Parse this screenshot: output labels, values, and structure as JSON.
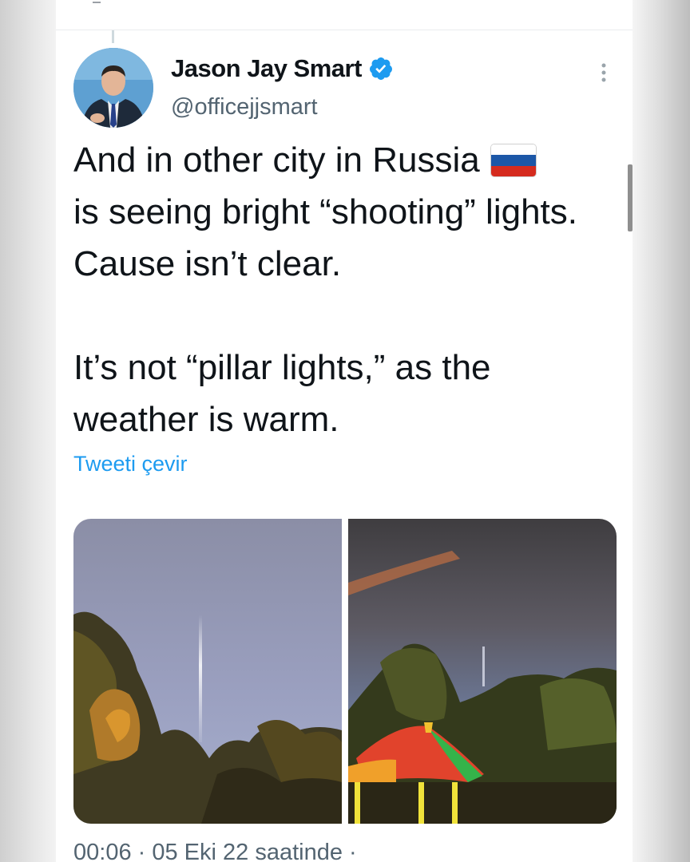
{
  "tweet": {
    "author_name": "Jason Jay Smart",
    "handle": "@officejjsmart",
    "text_line_1a": "And in other city in Russia",
    "text_line_1b": "is seeing bright “shooting” lights. Cause isn’t clear.",
    "text_para_2": "It’s not “pillar lights,” as the weather is warm.",
    "translate_label": "Tweeti çevir",
    "timestamp": "00:06 · 05 Eki 22 saatinde ·"
  },
  "icons": {
    "verified": "verified-badge-icon",
    "more": "more-vertical-icon",
    "flag": "russia-flag-icon"
  },
  "colors": {
    "verified": "#1d9bf0",
    "link": "#1d9bf0",
    "text": "#0f1419",
    "secondary": "#536471",
    "flag_white": "#ffffff",
    "flag_blue": "#1c57a7",
    "flag_red": "#d52b1e"
  }
}
